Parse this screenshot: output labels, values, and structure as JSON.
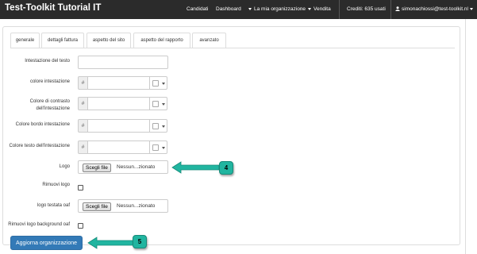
{
  "navbar": {
    "brand": "Test-Toolkit Tutorial IT",
    "links": {
      "candidati": "Candidati",
      "dashboard": "Dashboard",
      "organizzazione": "La mia organizzazione",
      "vendita": "Vendita"
    },
    "credits": "Crediti: 635 usati",
    "user_email": "simonachiossi@test-toolkit.nl"
  },
  "tabs": [
    {
      "label": "generale"
    },
    {
      "label": "dettagli fattura"
    },
    {
      "label": "aspetto del sito"
    },
    {
      "label": "aspetto del rapporto"
    },
    {
      "label": "avanzato"
    }
  ],
  "form": {
    "intestazione_testo": {
      "label": "Intestazione del testo",
      "value": ""
    },
    "colore_intestazione": {
      "label": "colore intestazione",
      "prefix": "#",
      "value": ""
    },
    "colore_contrasto": {
      "label": "Colore di contrasto dell'intestazione",
      "prefix": "#",
      "value": ""
    },
    "colore_bordo": {
      "label": "Colore bordo intestazione",
      "prefix": "#",
      "value": ""
    },
    "colore_testo": {
      "label": "Colore testo dell'intestazione",
      "prefix": "#",
      "value": ""
    },
    "logo": {
      "label": "Logo",
      "button": "Scegli file",
      "status": "Nessun...zionato"
    },
    "rimuovi_logo": {
      "label": "Rimuovi logo",
      "checked": false
    },
    "logo_testata": {
      "label": "logo testata oaf",
      "button": "Scegli file",
      "status": "Nessun...zionato"
    },
    "rimuovi_logo_bg": {
      "label": "Rimuovi logo background oaf",
      "checked": false
    }
  },
  "submit_label": "Aggiorna organizzazione",
  "annotations": [
    {
      "number": "4"
    },
    {
      "number": "5"
    }
  ],
  "colors": {
    "navbar_bg": "#2b2b2b",
    "primary_button": "#337ab7",
    "annotation": "#21b5a0"
  }
}
